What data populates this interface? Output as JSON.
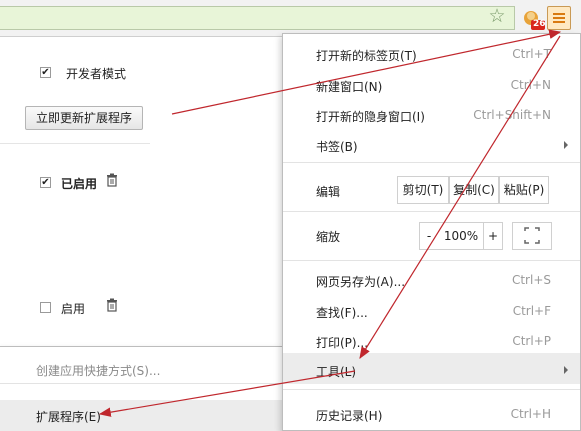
{
  "toolbar": {
    "extension_badge": "26"
  },
  "settings": {
    "developer_mode_label": "开发者模式",
    "update_button_label": "立即更新扩展程序",
    "ext1_enabled_label": "已启用",
    "ext2_enable_label": "启用"
  },
  "menu": {
    "new_tab": {
      "label": "打开新的标签页(T)",
      "shortcut": "Ctrl+T"
    },
    "new_window": {
      "label": "新建窗口(N)",
      "shortcut": "Ctrl+N"
    },
    "incognito": {
      "label": "打开新的隐身窗口(I)",
      "shortcut": "Ctrl+Shift+N"
    },
    "bookmarks": {
      "label": "书签(B)"
    },
    "edit": {
      "label": "编辑",
      "cut": "剪切(T)",
      "copy": "复制(C)",
      "paste": "粘贴(P)"
    },
    "zoom": {
      "label": "缩放",
      "minus": "-",
      "value": "100%",
      "plus": "+"
    },
    "save_as": {
      "label": "网页另存为(A)...",
      "shortcut": "Ctrl+S"
    },
    "find": {
      "label": "查找(F)...",
      "shortcut": "Ctrl+F"
    },
    "print": {
      "label": "打印(P)...",
      "shortcut": "Ctrl+P"
    },
    "tools": {
      "label": "工具(L)"
    },
    "history": {
      "label": "历史记录(H)",
      "shortcut": "Ctrl+H"
    }
  },
  "submenu": {
    "create_shortcut": "创建应用快捷方式(S)...",
    "extensions": "扩展程序(E)"
  },
  "colors": {
    "annotation_arrow": "#c0272d",
    "hover_highlight": "#ececec",
    "disabled_text": "#8a8a8a"
  }
}
